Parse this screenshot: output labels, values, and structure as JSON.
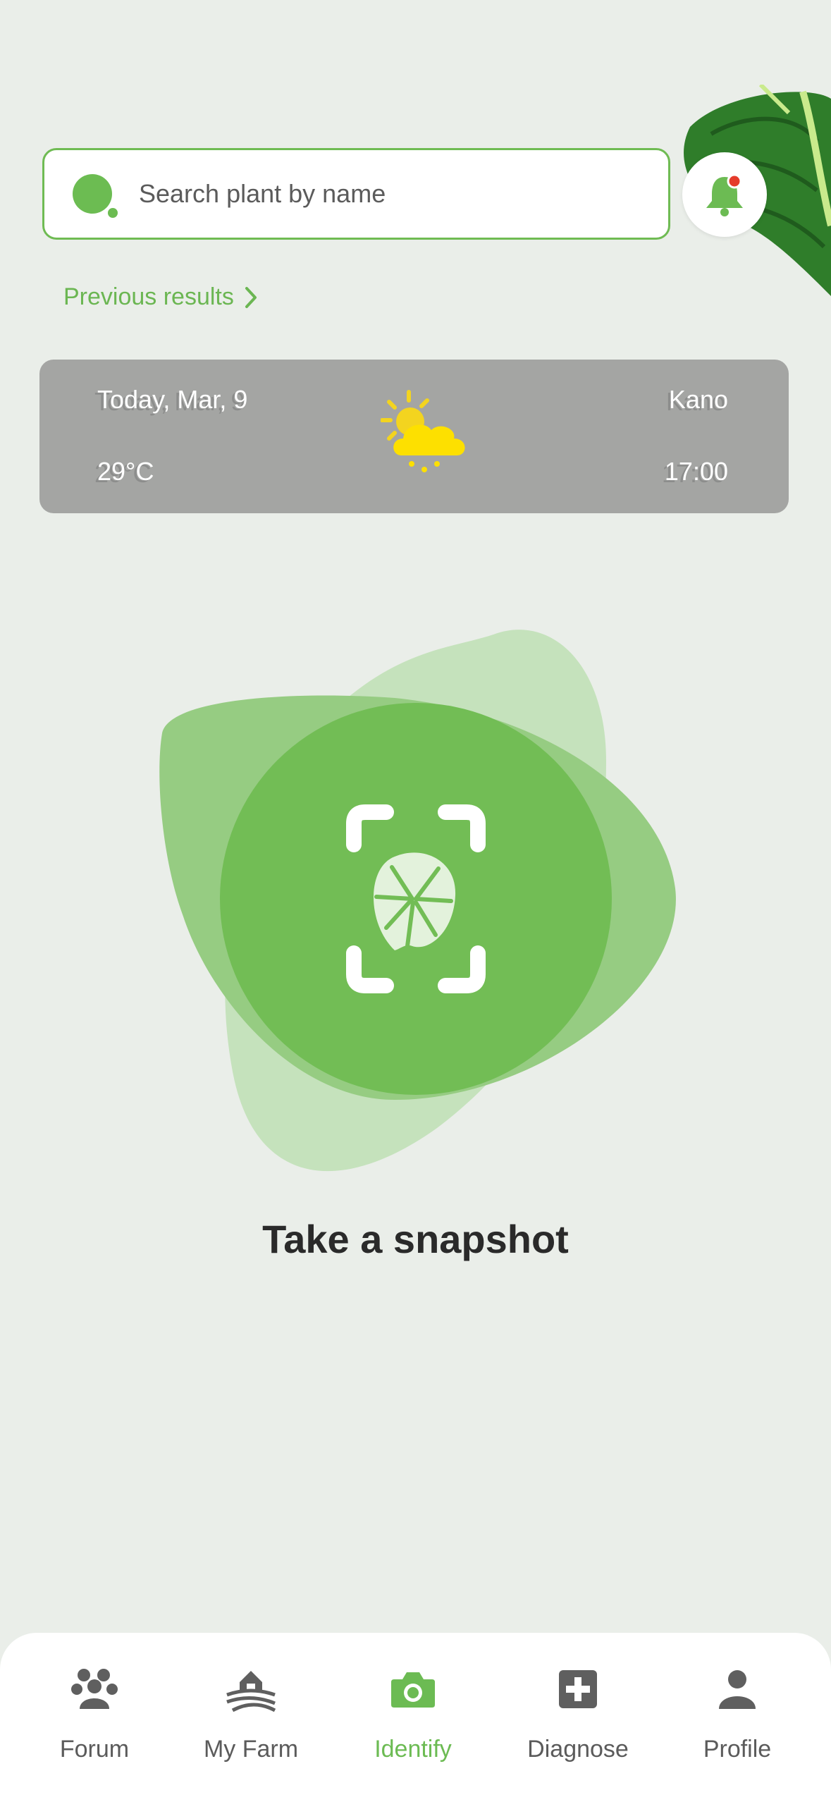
{
  "search": {
    "placeholder": "Search plant by name"
  },
  "previous_results": {
    "label": "Previous results"
  },
  "weather": {
    "date": "Today, Mar, 9",
    "temperature": "29°C",
    "location": "Kano",
    "time": "17:00",
    "icon": "partly-sunny-rain-icon"
  },
  "snapshot": {
    "label": "Take a snapshot"
  },
  "nav": {
    "items": [
      {
        "label": "Forum",
        "icon": "forum-icon",
        "active": false
      },
      {
        "label": "My Farm",
        "icon": "farm-icon",
        "active": false
      },
      {
        "label": "Identify",
        "icon": "camera-icon",
        "active": true
      },
      {
        "label": "Diagnose",
        "icon": "diagnose-icon",
        "active": false
      },
      {
        "label": "Profile",
        "icon": "profile-icon",
        "active": false
      }
    ]
  },
  "colors": {
    "accent": "#6cbb53",
    "background": "#eaeee9",
    "weather_card": "#a4a5a3",
    "notification_dot": "#e53b2b"
  }
}
